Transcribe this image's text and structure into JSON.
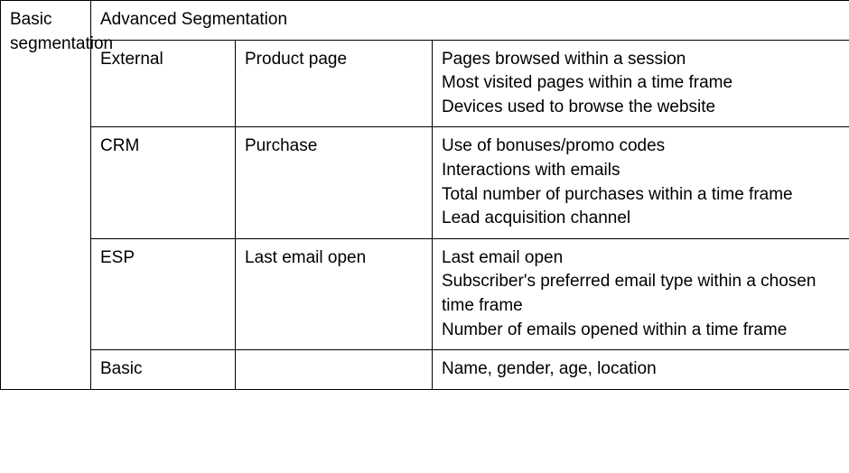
{
  "left_header": "Basic segmentation",
  "advanced_header": "Advanced Segmentation",
  "rows": [
    {
      "col1": "External",
      "col2": "Product page",
      "col3": [
        "Pages browsed within a session",
        "Most visited pages within a time frame",
        "Devices used to browse the website"
      ]
    },
    {
      "col1": "CRM",
      "col2": "Purchase",
      "col3": [
        "Use of bonuses/promo codes",
        "Interactions with emails",
        "Total number of purchases within a time frame",
        "Lead acquisition channel"
      ]
    },
    {
      "col1": "ESP",
      "col2": "Last email open",
      "col3": [
        "Last email open",
        "Subscriber's preferred email type within a chosen time frame",
        "Number of emails opened within a time frame"
      ]
    },
    {
      "col1": "Basic",
      "col2": "",
      "col3": [
        "Name, gender, age, location"
      ]
    }
  ]
}
